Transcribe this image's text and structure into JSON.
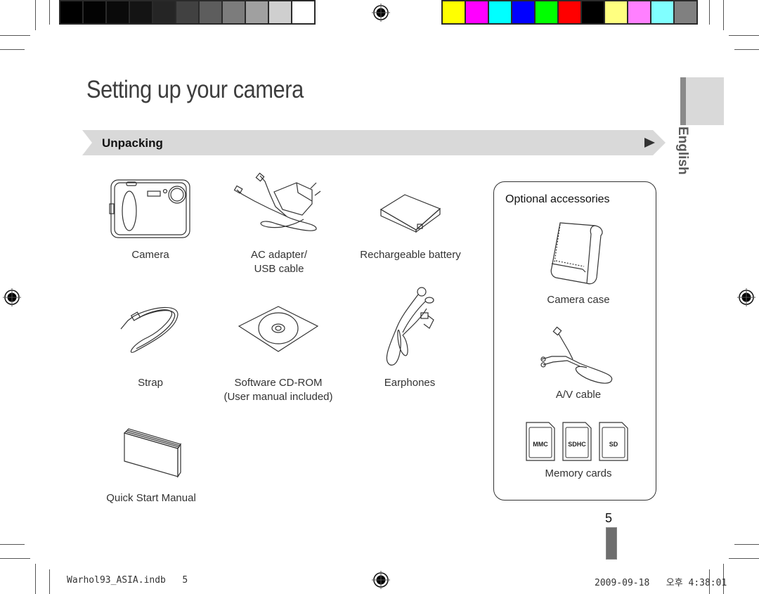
{
  "print_marks": {
    "gray_swatches": [
      "#000000",
      "#030303",
      "#0a0a0a",
      "#141414",
      "#252525",
      "#414141",
      "#5d5d5d",
      "#7c7c7c",
      "#a0a0a0",
      "#cfcfcf",
      "#ffffff"
    ],
    "color_swatches": [
      "#ffff00",
      "#ff00ff",
      "#00ffff",
      "#0000ff",
      "#00ff00",
      "#ff0000",
      "#000000",
      "#ffff80",
      "#ff80ff",
      "#80ffff",
      "#808080"
    ],
    "registration_icon": "crosshair-target"
  },
  "page": {
    "title": "Setting up your camera",
    "section": "Unpacking",
    "language_tab": "English",
    "page_number": "5"
  },
  "included_items": [
    {
      "label": "Camera",
      "icon": "camera-icon"
    },
    {
      "label": "AC adapter/",
      "label2": "USB cable",
      "icon": "ac-adapter-icon"
    },
    {
      "label": "Rechargeable battery",
      "icon": "battery-icon"
    },
    {
      "label": "Strap",
      "icon": "strap-icon"
    },
    {
      "label": "Software CD-ROM",
      "label2": "(User manual included)",
      "icon": "cd-rom-icon"
    },
    {
      "label": "Earphones",
      "icon": "earphones-icon"
    },
    {
      "label": "Quick Start Manual",
      "icon": "manual-icon"
    }
  ],
  "optional_accessories": {
    "title": "Optional accessories",
    "items": [
      {
        "label": "Camera case",
        "icon": "camera-case-icon"
      },
      {
        "label": "A/V cable",
        "icon": "av-cable-icon"
      },
      {
        "label": "Memory cards",
        "icon": "memory-cards-icon",
        "cards": [
          "MMC",
          "SDHC",
          "SD"
        ]
      }
    ]
  },
  "footer": {
    "file": "Warhol93_ASIA.indb   5",
    "timestamp": "2009-09-18   오후 4:38:01"
  }
}
